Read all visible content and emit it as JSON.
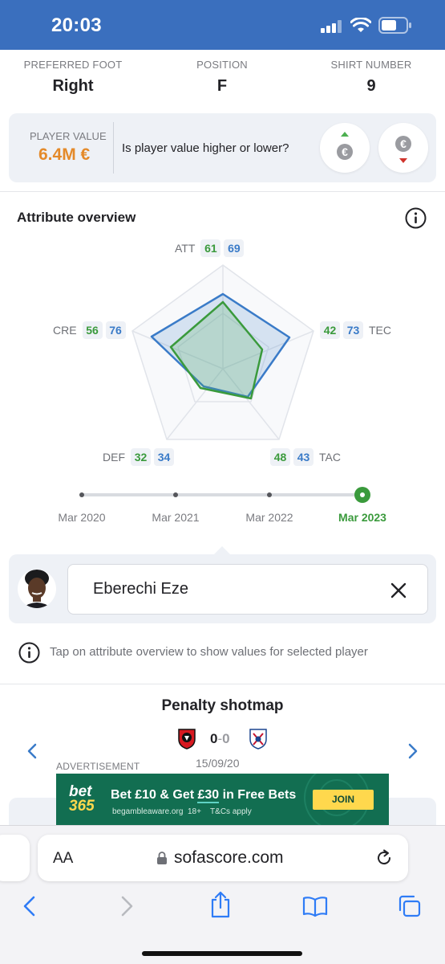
{
  "status_bar": {
    "time": "20:03"
  },
  "player_info": [
    {
      "label": "PREFERRED FOOT",
      "value": "Right"
    },
    {
      "label": "POSITION",
      "value": "F"
    },
    {
      "label": "SHIRT NUMBER",
      "value": "9"
    }
  ],
  "player_value": {
    "label": "PLAYER VALUE",
    "value": "6.4M €",
    "question": "Is player value higher or lower?",
    "vote_icons": [
      "euro-up-icon",
      "euro-down-icon"
    ]
  },
  "attribute_overview": {
    "title": "Attribute overview",
    "attributes": [
      {
        "name": "ATT",
        "green": "61",
        "blue": "69"
      },
      {
        "name": "TEC",
        "green": "42",
        "blue": "73"
      },
      {
        "name": "TAC",
        "green": "48",
        "blue": "43"
      },
      {
        "name": "DEF",
        "green": "32",
        "blue": "34"
      },
      {
        "name": "CRE",
        "green": "56",
        "blue": "76"
      }
    ],
    "colors": {
      "green": "#3a9a3c",
      "blue": "#3a7bc8"
    },
    "timeline": [
      "Mar 2020",
      "Mar 2021",
      "Mar 2022",
      "Mar 2023"
    ],
    "timeline_selected": "Mar 2023"
  },
  "player_search": {
    "value": "Eberechi Eze"
  },
  "tip": "Tap on attribute overview to show values for selected player",
  "shotmap": {
    "title": "Penalty shotmap",
    "home_score": "0",
    "separator": "-",
    "away_score": "0",
    "date": "15/09/20"
  },
  "advertisement": {
    "label": "ADVERTISEMENT",
    "logo_top": "bet",
    "logo_bottom": "365",
    "headline_pre": "Bet £10 & Get ",
    "headline_amount": "£30",
    "headline_post": " in Free Bets",
    "fine_print_1": "begambleaware.org",
    "fine_print_2": "18+",
    "fine_print_3": "T&Cs apply",
    "cta": "JOIN"
  },
  "browser": {
    "text_size": "AA",
    "url": "sofascore.com"
  }
}
